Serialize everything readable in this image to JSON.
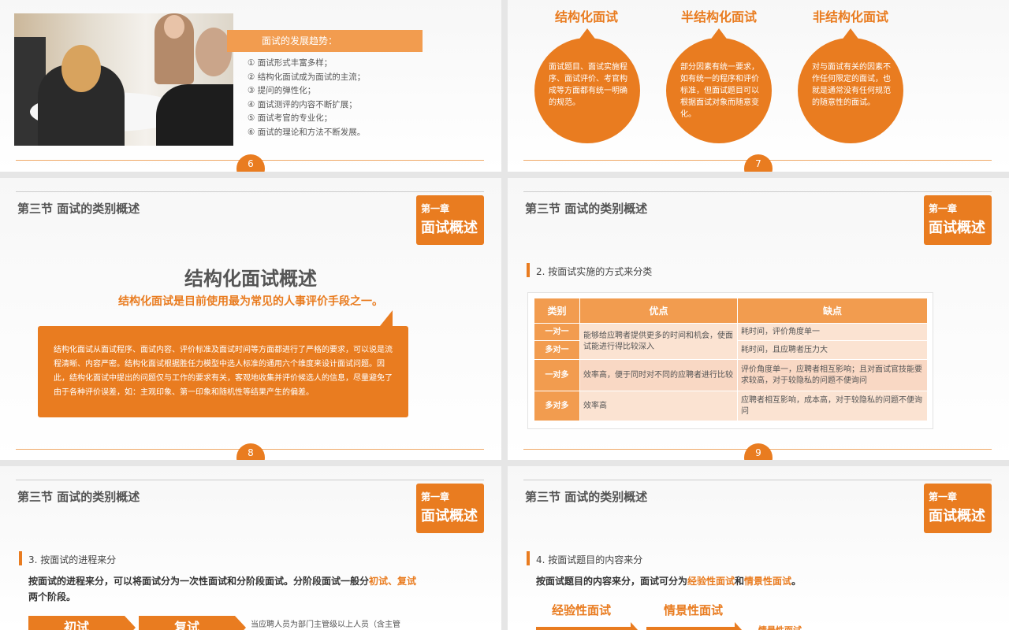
{
  "slide6": {
    "trend_title": "面试的发展趋势：",
    "trends": [
      "①  面试形式丰富多样；",
      "②  结构化面试成为面试的主流；",
      "③  提问的弹性化；",
      "④  面试测评的内容不断扩展；",
      "⑤  面试考官的专业化；",
      "⑥  面试的理论和方法不断发展。"
    ],
    "page": "6"
  },
  "slide7": {
    "bubbles": [
      {
        "title": "结构化面试",
        "text": "面试题目、面试实施程序、面试评价、考官构成等方面都有统一明确的规范。"
      },
      {
        "title": "半结构化面试",
        "text": "部分因素有统一要求，如有统一的程序和评价标准，但面试题目可以根据面试对象而随意变化。"
      },
      {
        "title": "非结构化面试",
        "text": "对与面试有关的因素不作任何限定的面试，也就是通常没有任何规范的随意性的面试。"
      }
    ],
    "page": "7"
  },
  "common": {
    "section_title": "第三节  面试的类别概述",
    "chapter_small": "第一章",
    "chapter_big": "面试概述"
  },
  "slide8": {
    "title": "结构化面试概述",
    "subtitle": "结构化面试是目前使用最为常见的人事评价手段之一。",
    "body": "结构化面试从面试程序、面试内容、评价标准及面试时间等方面都进行了严格的要求，可以说是流程清晰、内容严密。结构化面试根据胜任力模型中选人标准的通用六个维度来设计面试问题。因此，结构化面试中提出的问题仅与工作的要求有关，客观地收集并评价候选人的信息，尽量避免了由于各种评价误差，如：主观印象、第一印象和随机性等结果产生的偏差。",
    "page": "8"
  },
  "slide9": {
    "heading": "2. 按面试实施的方式来分类",
    "headers": [
      "类别",
      "优点",
      "缺点"
    ],
    "rows": [
      {
        "cat": "一对一",
        "pro": "能够给应聘者提供更多的时间和机会，使面试能进行得比较深入",
        "con": "耗时间，评价角度单一"
      },
      {
        "cat": "多对一",
        "con": "耗时间，且应聘者压力大"
      },
      {
        "cat": "一对多",
        "pro": "效率高，便于同时对不同的应聘者进行比较",
        "con": "评价角度单一，应聘者相互影响；且对面试官技能要求较高，对于较隐私的问题不便询问"
      },
      {
        "cat": "多对多",
        "pro": "效率高",
        "con": "应聘者相互影响，成本高，对于较隐私的问题不便询问"
      }
    ],
    "page": "9"
  },
  "slide10": {
    "heading": "3. 按面试的进程来分",
    "para_a": "按面试的进程来分，可以将面试分为一次性面试和分阶段面试。分阶段面试一般分",
    "hl1": "初试",
    "sep": "、",
    "hl2": "复试",
    "para_b": "两个阶段。",
    "box1": "初试",
    "box2": "复试",
    "note": "当应聘人员为部门主管级以上人员（含主管"
  },
  "slide11": {
    "heading": "4. 按面试题目的内容来分",
    "para_a": "按面试题目的内容来分，面试可分为",
    "hl1": "经验性面试",
    "mid": "和",
    "hl2": "情景性面试",
    "para_b": "。",
    "label1": "经验性面试",
    "label2": "情景性面试",
    "small": "情景性面试"
  }
}
